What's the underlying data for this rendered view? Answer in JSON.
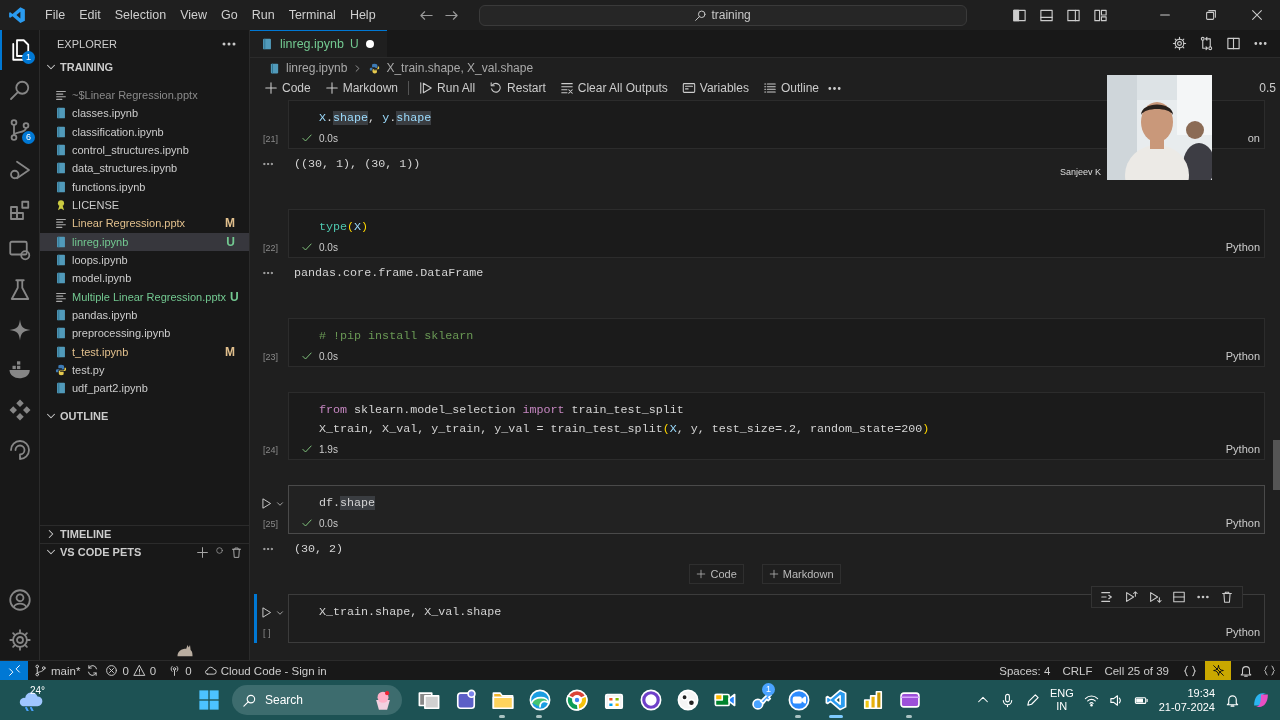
{
  "title_bar": {
    "menu": [
      "File",
      "Edit",
      "Selection",
      "View",
      "Go",
      "Run",
      "Terminal",
      "Help"
    ],
    "command_center": "training"
  },
  "activity_bar": {
    "items": [
      {
        "kind": "files",
        "selected": true,
        "badge": "1"
      },
      {
        "kind": "search",
        "selected": false
      },
      {
        "kind": "branch",
        "selected": false,
        "badge": "6"
      },
      {
        "kind": "run",
        "selected": false
      },
      {
        "kind": "blocks",
        "selected": false
      },
      {
        "kind": "monitor",
        "selected": false
      },
      {
        "kind": "flask",
        "selected": false
      },
      {
        "kind": "sparkle",
        "selected": false
      },
      {
        "kind": "whale",
        "selected": false
      },
      {
        "kind": "diamonds",
        "selected": false
      },
      {
        "kind": "swirl",
        "selected": false
      }
    ]
  },
  "sidebar": {
    "title": "EXPLORER",
    "workspace": {
      "title": "TRAINING",
      "expanded": true,
      "files": [
        {
          "name": "~$Linear Regression.pptx",
          "kind": "lines",
          "selected": false,
          "dim": true
        },
        {
          "name": "classes.ipynb",
          "kind": "notebook",
          "selected": false
        },
        {
          "name": "classification.ipynb",
          "kind": "notebook",
          "selected": false
        },
        {
          "name": "control_structures.ipynb",
          "kind": "notebook",
          "selected": false
        },
        {
          "name": "data_structures.ipynb",
          "kind": "notebook",
          "selected": false
        },
        {
          "name": "functions.ipynb",
          "kind": "notebook",
          "selected": false
        },
        {
          "name": "LICENSE",
          "kind": "ribbon",
          "selected": false
        },
        {
          "name": "Linear Regression.pptx",
          "kind": "lines",
          "selected": false,
          "decoration": "M",
          "color": "#e2c08d"
        },
        {
          "name": "linreg.ipynb",
          "kind": "notebook",
          "selected": true,
          "decoration": "U",
          "color": "#73c991"
        },
        {
          "name": "loops.ipynb",
          "kind": "notebook",
          "selected": false
        },
        {
          "name": "model.ipynb",
          "kind": "notebook",
          "selected": false
        },
        {
          "name": "Multiple Linear Regression.pptx",
          "kind": "lines",
          "selected": false,
          "decoration": "U",
          "color": "#73c991"
        },
        {
          "name": "pandas.ipynb",
          "kind": "notebook",
          "selected": false
        },
        {
          "name": "preprocessing.ipynb",
          "kind": "notebook",
          "selected": false
        },
        {
          "name": "t_test.ipynb",
          "kind": "notebook",
          "selected": false,
          "decoration": "M",
          "color": "#e2c08d"
        },
        {
          "name": "test.py",
          "kind": "python",
          "selected": false
        },
        {
          "name": "udf_part2.ipynb",
          "kind": "notebook",
          "selected": false
        }
      ]
    },
    "outline": {
      "title": "OUTLINE",
      "expanded": true
    },
    "timeline": {
      "title": "TIMELINE",
      "expanded": false
    },
    "pets": {
      "title": "VS CODE PETS",
      "expanded": true
    }
  },
  "editor": {
    "tab": {
      "label": "linreg.ipynb",
      "decoration": "U",
      "color": "#73c991",
      "dirty": true,
      "selected": true
    },
    "breadcrumbs": [
      "linreg.ipynb",
      "X_train.shape, X_val.shape"
    ],
    "toolbar": [
      {
        "kind": "add",
        "label": "Code"
      },
      {
        "kind": "add",
        "label": "Markdown"
      },
      {
        "kind": "run-all",
        "label": "Run All"
      },
      {
        "kind": "restart",
        "label": "Restart"
      },
      {
        "kind": "clear",
        "label": "Clear All Outputs"
      },
      {
        "kind": "variables",
        "label": "Variables"
      },
      {
        "kind": "outline",
        "label": "Outline"
      }
    ],
    "toolbar_overflow": "0.5",
    "video": {
      "kind": "picture",
      "name": "Sanjeev K"
    },
    "cells": [
      {
        "count": "[21]",
        "done": true,
        "time": "0.0s",
        "language": "on",
        "focused": false,
        "hovered": false,
        "lines": [
          [
            {
              "text": "X",
              "kind": "var"
            },
            {
              "text": ".",
              "kind": "plain"
            },
            {
              "text": "shape",
              "kind": "var",
              "hl": true
            },
            {
              "text": ", ",
              "kind": "plain"
            },
            {
              "text": "y",
              "kind": "var"
            },
            {
              "text": ".",
              "kind": "plain"
            },
            {
              "text": "shape",
              "kind": "var",
              "hl": true
            }
          ]
        ],
        "output": "((30, 1), (30, 1))"
      },
      {
        "count": "[22]",
        "done": true,
        "time": "0.0s",
        "language": "Python",
        "focused": false,
        "hovered": false,
        "lines": [
          [
            {
              "text": "type",
              "kind": "type"
            },
            {
              "text": "(",
              "kind": "paren"
            },
            {
              "text": "X",
              "kind": "var"
            },
            {
              "text": ")",
              "kind": "paren"
            }
          ]
        ],
        "output": "pandas.core.frame.DataFrame"
      },
      {
        "count": "[23]",
        "done": true,
        "time": "0.0s",
        "language": "Python",
        "focused": false,
        "hovered": false,
        "lines": [
          [
            {
              "text": "# !pip install sklearn",
              "kind": "comment"
            }
          ]
        ]
      },
      {
        "count": "[24]",
        "done": true,
        "time": "1.9s",
        "language": "Python",
        "focused": false,
        "hovered": false,
        "lines": [
          [
            {
              "text": "from",
              "kind": "kw"
            },
            {
              "text": " sklearn.model_selection ",
              "kind": "plain"
            },
            {
              "text": "import",
              "kind": "kw"
            },
            {
              "text": " train_test_split",
              "kind": "plain"
            }
          ],
          [
            {
              "text": "X_train, X_val, y_train, y_val = train_test_split",
              "kind": "plain"
            },
            {
              "text": "(",
              "kind": "paren"
            },
            {
              "text": "X",
              "kind": "var"
            },
            {
              "text": ", y, test_size=.2, random_state=200",
              "kind": "plain"
            },
            {
              "text": ")",
              "kind": "paren"
            }
          ]
        ]
      },
      {
        "count": "[25]",
        "done": true,
        "time": "0.0s",
        "language": "Python",
        "focused": false,
        "hovered": true,
        "lines": [
          [
            {
              "text": "df.",
              "kind": "plain"
            },
            {
              "text": "shape",
              "kind": "plain",
              "hl": true
            }
          ]
        ],
        "output": "(30, 2)",
        "add_buttons": [
          {
            "label": "Code"
          },
          {
            "label": "Markdown"
          }
        ]
      },
      {
        "count": "[ ]",
        "done": false,
        "language": "Python",
        "focused": true,
        "hovered": false,
        "lines": [
          [
            {
              "text": "X_train.shape, X_val.shape",
              "kind": "plain"
            }
          ]
        ]
      }
    ]
  },
  "status_bar": {
    "branch": "main*",
    "errors": "0",
    "warnings": "0",
    "ports": "0",
    "cloud": "Cloud Code - Sign in",
    "right": [
      "Spaces: 4",
      "CRLF",
      "Cell 25 of 39"
    ]
  },
  "taskbar": {
    "weather": "24°",
    "search_placeholder": "Search",
    "apps": [
      {
        "kind": "squares",
        "running": false
      },
      {
        "kind": "tile",
        "running": false
      },
      {
        "kind": "folder",
        "running": true
      },
      {
        "kind": "wave",
        "running": true
      },
      {
        "kind": "ring",
        "running": false
      },
      {
        "kind": "bag",
        "running": false
      },
      {
        "kind": "octo",
        "running": false
      },
      {
        "kind": "spots",
        "running": false
      },
      {
        "kind": "camera",
        "running": false
      },
      {
        "kind": "key",
        "running": false,
        "badge": "1"
      },
      {
        "kind": "dot",
        "running": true
      },
      {
        "kind": "ribbon",
        "running": true,
        "active": true
      },
      {
        "kind": "bars",
        "running": false
      },
      {
        "kind": "film",
        "running": true
      }
    ],
    "language": [
      "ENG",
      "IN"
    ],
    "time": "19:34",
    "date": "21-07-2024"
  }
}
